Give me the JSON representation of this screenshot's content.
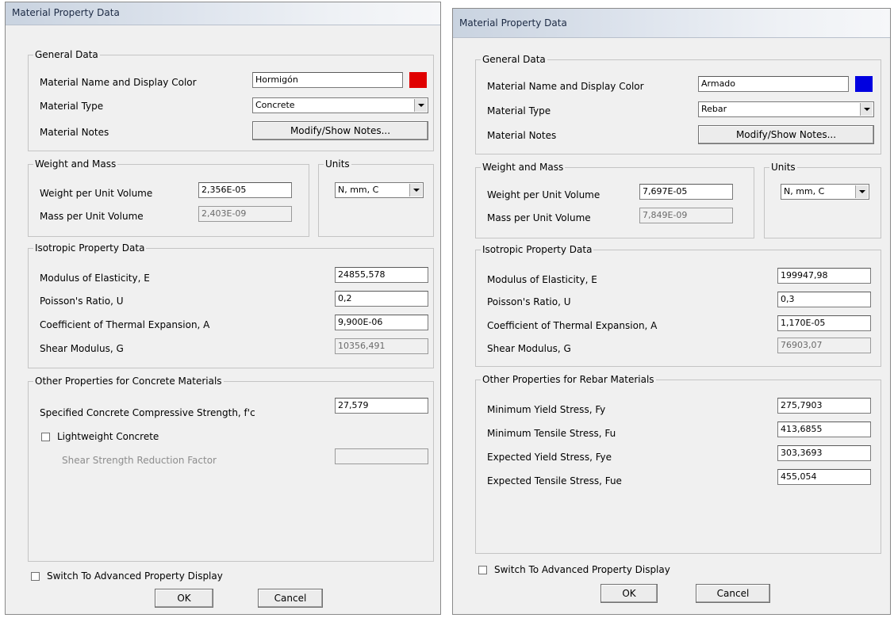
{
  "left": {
    "title": "Material Property Data",
    "general": {
      "heading": "General Data",
      "name_label": "Material Name and Display Color",
      "name_value": "Hormigón",
      "color": "#e00000",
      "type_label": "Material Type",
      "type_value": "Concrete",
      "notes_label": "Material Notes",
      "notes_button": "Modify/Show Notes..."
    },
    "weight": {
      "heading": "Weight and Mass",
      "wpuv_label": "Weight per Unit Volume",
      "wpuv_value": "2,356E-05",
      "mpuv_label": "Mass per Unit Volume",
      "mpuv_value": "2,403E-09"
    },
    "units": {
      "heading": "Units",
      "value": "N, mm, C"
    },
    "isotropic": {
      "heading": "Isotropic Property Data",
      "e_label": "Modulus of Elasticity,  E",
      "e_value": "24855,578",
      "u_label": "Poisson's Ratio,  U",
      "u_value": "0,2",
      "a_label": "Coefficient of Thermal Expansion,  A",
      "a_value": "9,900E-06",
      "g_label": "Shear Modulus,  G",
      "g_value": "10356,491"
    },
    "other": {
      "heading": "Other Properties for Concrete Materials",
      "fc_label": "Specified Concrete Compressive Strength, f'c",
      "fc_value": "27,579",
      "lightweight_label": "Lightweight Concrete",
      "ssrf_label": "Shear Strength Reduction Factor",
      "ssrf_value": ""
    },
    "advanced_label": "Switch To Advanced Property Display",
    "ok": "OK",
    "cancel": "Cancel"
  },
  "right": {
    "title": "Material Property Data",
    "general": {
      "heading": "General Data",
      "name_label": "Material Name and Display Color",
      "name_value": "Armado",
      "color": "#0000e0",
      "type_label": "Material Type",
      "type_value": "Rebar",
      "notes_label": "Material Notes",
      "notes_button": "Modify/Show Notes..."
    },
    "weight": {
      "heading": "Weight and Mass",
      "wpuv_label": "Weight per Unit Volume",
      "wpuv_value": "7,697E-05",
      "mpuv_label": "Mass per Unit Volume",
      "mpuv_value": "7,849E-09"
    },
    "units": {
      "heading": "Units",
      "value": "N, mm, C"
    },
    "isotropic": {
      "heading": "Isotropic Property Data",
      "e_label": "Modulus of Elasticity,  E",
      "e_value": "199947,98",
      "u_label": "Poisson's Ratio,  U",
      "u_value": "0,3",
      "a_label": "Coefficient of Thermal Expansion,  A",
      "a_value": "1,170E-05",
      "g_label": "Shear Modulus,  G",
      "g_value": "76903,07"
    },
    "other": {
      "heading": "Other Properties for Rebar Materials",
      "fy_label": "Minimum Yield Stress, Fy",
      "fy_value": "275,7903",
      "fu_label": "Minimum Tensile Stress, Fu",
      "fu_value": "413,6855",
      "fye_label": "Expected Yield Stress, Fye",
      "fye_value": "303,3693",
      "fue_label": "Expected Tensile Stress, Fue",
      "fue_value": "455,054"
    },
    "advanced_label": "Switch To Advanced Property Display",
    "ok": "OK",
    "cancel": "Cancel"
  }
}
